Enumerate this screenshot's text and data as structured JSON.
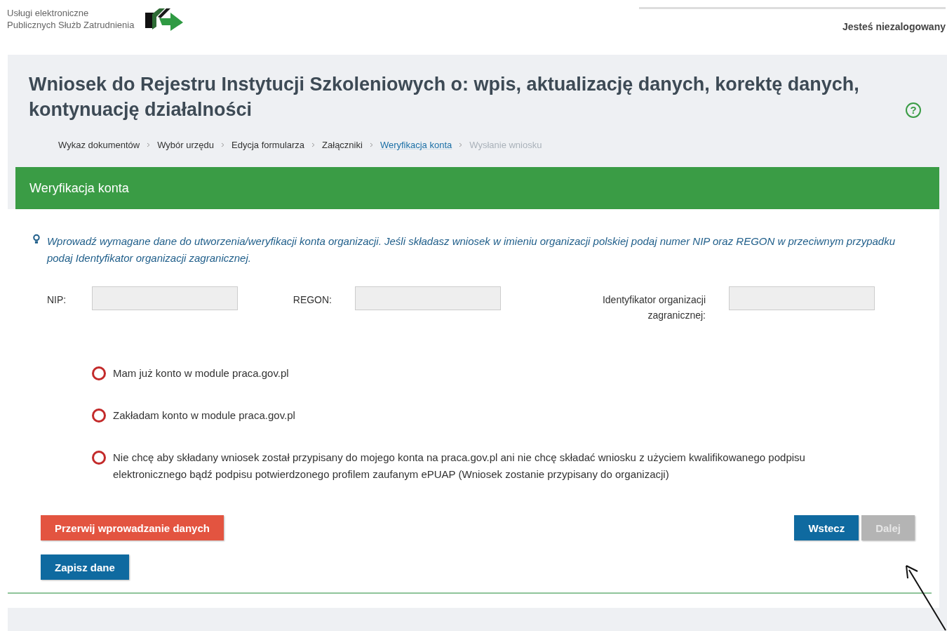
{
  "header": {
    "brand_line_1": "Usługi elektroniczne",
    "brand_line_2": "Publicznych Służb Zatrudnienia",
    "login_status": "Jesteś niezalogowany"
  },
  "title": "Wniosek do Rejestru Instytucji Szkoleniowych o: wpis, aktualizację danych, korektę danych, kontynuację działalności",
  "help_icon": "?",
  "breadcrumb": [
    {
      "label": "Wykaz dokumentów",
      "selected": false,
      "disabled": false
    },
    {
      "label": "Wybór urzędu",
      "selected": false,
      "disabled": false
    },
    {
      "label": "Edycja formularza",
      "selected": false,
      "disabled": false
    },
    {
      "label": "Załączniki",
      "selected": false,
      "disabled": false
    },
    {
      "label": "Weryfikacja konta",
      "selected": true,
      "disabled": false
    },
    {
      "label": "Wysłanie wniosku",
      "selected": false,
      "disabled": true
    }
  ],
  "section_title": "Weryfikacja konta",
  "info": "Wprowadź wymagane dane do utworzenia/weryfikacji konta organizacji. Jeśli składasz wniosek w imieniu organizacji polskiej podaj numer NIP oraz REGON w przeciwnym przypadku podaj Identyfikator organizacji zagranicznej.",
  "fields": [
    {
      "label": "NIP:"
    },
    {
      "label": "REGON:"
    },
    {
      "label": "Identyfikator organizacji zagranicznej:"
    }
  ],
  "options": [
    {
      "label": "Mam już konto w module praca.gov.pl",
      "selected": false
    },
    {
      "label": "Zakładam konto w module praca.gov.pl",
      "selected": false
    },
    {
      "label": "Nie chcę aby składany wniosek został przypisany do mojego konta na praca.gov.pl ani nie chcę składać wniosku z użyciem kwalifikowanego podpisu elektronicznego bądź podpisu potwierdzonego profilem zaufanym ePUAP (Wniosek zostanie przypisany do organizacji)",
      "selected": false
    }
  ],
  "buttons": [
    {
      "label": "Przerwij wprowadzanie danych",
      "kind": "danger",
      "disabled": false
    },
    {
      "label": "Zapisz dane",
      "kind": "primary",
      "disabled": false
    },
    {
      "label": "Wstecz",
      "kind": "primary",
      "disabled": false
    },
    {
      "label": "Dalej",
      "kind": "primary",
      "disabled": true
    }
  ]
}
